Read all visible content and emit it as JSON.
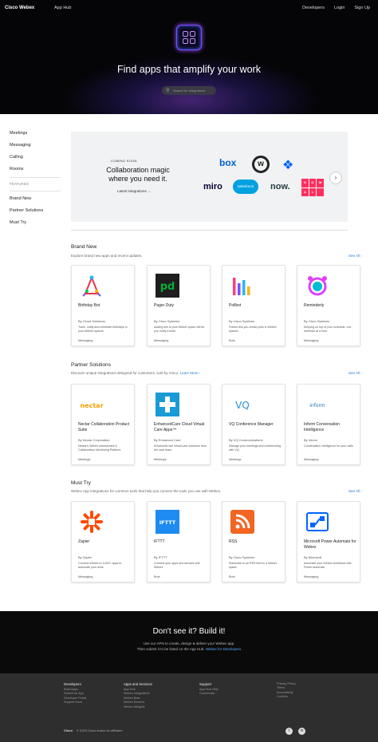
{
  "nav": {
    "brand": "Cisco Webex",
    "apphub": "App Hub",
    "right": [
      "Developers",
      "Login",
      "Sign Up"
    ]
  },
  "hero": {
    "title": "Find apps that amplify your work",
    "search_placeholder": "Search for integrations"
  },
  "sidebar": {
    "items": [
      "Meetings",
      "Messaging",
      "Calling",
      "Rooms"
    ],
    "section_label": "FEATURED",
    "featured": [
      "Brand New",
      "Partner Solutions",
      "Must Try"
    ]
  },
  "banner": {
    "coming_soon": "COMING SOON",
    "title": "Collaboration magic where you need it.",
    "link": "Latest integrations →",
    "logos": {
      "box": "box",
      "webex": "w",
      "dropbox": "❖",
      "miro": "miro",
      "salesforce": "salesforce",
      "now": "now.",
      "nowal": [
        "N",
        "O",
        "W",
        "A",
        "L",
        ""
      ]
    }
  },
  "sections": [
    {
      "title": "Brand New",
      "desc": "Explore brand new apps and recent updates.",
      "see_all": "See All ›",
      "cards": [
        {
          "name": "Birthday Bot",
          "by": "By Cloud Solutions",
          "desc": "Track, notify and celebrate birthdays in your Webex spaces.",
          "type": "Messaging"
        },
        {
          "name": "Pager Duty",
          "by": "By Cisco Systems",
          "desc": "Adding this to your Webex space will let you notify a team.",
          "type": "Messaging"
        },
        {
          "name": "Pollbot",
          "by": "By Cisco Systems",
          "desc": "Pollbot lets you create polls in Webex spaces.",
          "type": "Bots"
        },
        {
          "name": "Reminderly",
          "by": "By Cisco Systems",
          "desc": "Keeping on top of your schedule, one reminder at a time.",
          "type": "Messaging"
        }
      ]
    },
    {
      "title": "Partner Solutions",
      "desc": "Discover unique integrations designed for customers, sold by Cisco.",
      "desc_link": "Learn More ›",
      "see_all": "See All ›",
      "cards": [
        {
          "name": "Nectar Collaboration Product Suite",
          "by": "By Nectar Corporation",
          "desc": "Nectar's Webex Assessment & Collaboration Monitoring Platform.",
          "type": "Meetings"
        },
        {
          "name": "EnhancedCare Cloud Virtual Care Apps™",
          "by": "By Enhanced Care",
          "desc": "EnhancedCare virtual care solutions from the care team.",
          "type": "Meetings"
        },
        {
          "name": "VQ Conference Manager",
          "by": "By VQ Communications",
          "desc": "Manage your meetings and conferencing with VQ.",
          "type": "Meetings"
        },
        {
          "name": "Inform Conversation Intelligence",
          "by": "By Inform",
          "desc": "Conversation intelligence for your calls.",
          "type": "Messaging"
        }
      ]
    },
    {
      "title": "Must Try",
      "desc": "Webex App integrations for common tools that help you connect the tools you use with Webex.",
      "see_all": "See All ›",
      "cards": [
        {
          "name": "Zapier",
          "by": "By Zapier",
          "desc": "Connect Webex to 3,000+ apps to automate your work.",
          "type": "Messaging"
        },
        {
          "name": "IFTTT",
          "by": "By IFTTT",
          "desc": "Connect your apps and devices with Webex.",
          "type": "Bots"
        },
        {
          "name": "RSS",
          "by": "By Cisco Systems",
          "desc": "Subscribe to an RSS feed in a Webex space.",
          "type": "Bots"
        },
        {
          "name": "Microsoft Power Automate for Webex",
          "by": "By Microsoft",
          "desc": "Automate your Webex workflows with Power Automate.",
          "type": "Messaging"
        }
      ]
    }
  ],
  "buildit": {
    "title": "Don't see it? Build it!",
    "line1": "Use our APIs to create, design & deliver your Webex app.",
    "line2": "Then submit it to be listed on the App Hub.",
    "line2_link": "Webex for Developers"
  },
  "footer": {
    "cols": [
      {
        "head": "Developers",
        "links": [
          "Build Apps",
          "Submit an App",
          "Developer Portal",
          "Support Docs"
        ]
      },
      {
        "head": "Apps and Services",
        "links": [
          "App Hub",
          "Webex Integrations",
          "Webex Bots",
          "Webex Devices",
          "Webex Widgets"
        ]
      },
      {
        "head": "Support",
        "links": [
          "App Hub Help",
          "Community"
        ]
      },
      {
        "head": "",
        "links": [
          "Privacy Policy",
          "Terms",
          "Accessibility",
          "Cookies"
        ]
      }
    ],
    "copyright_brand": "Cisco",
    "copyright": "© 2023 Cisco and/or its affiliates"
  },
  "colors": {
    "accent": "#2b78d0",
    "hero_bg": "#050508",
    "footer_bg": "#2e2e2e"
  }
}
